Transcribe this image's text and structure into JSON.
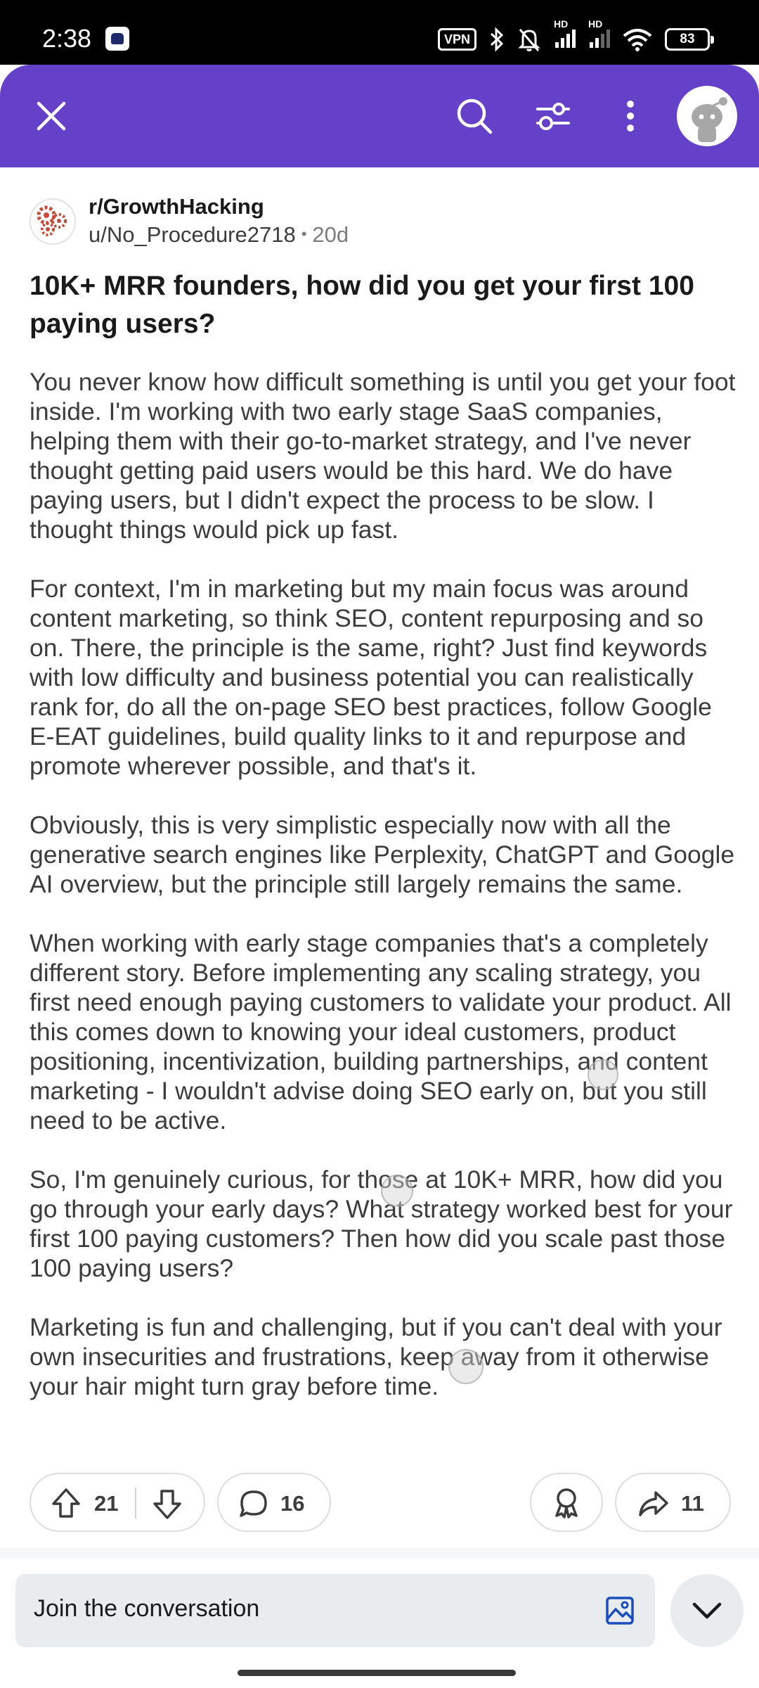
{
  "status_bar": {
    "time": "2:38",
    "vpn": "VPN",
    "sim1": "HD",
    "sim2": "HD",
    "battery": "83"
  },
  "header": {
    "icons": [
      "close-icon",
      "search-icon",
      "filter-icon",
      "more-vertical-icon",
      "avatar"
    ],
    "accent_color": "#6441c8"
  },
  "post": {
    "subreddit": "r/GrowthHacking",
    "author": "u/No_Procedure2718",
    "separator": "•",
    "age": "20d",
    "title": "10K+ MRR founders, how did you get your first 100 paying users?",
    "paragraphs": [
      "You never know how difficult something is until you get your foot inside. I'm working with two early stage SaaS companies, helping them with their go-to-market strategy, and I've never thought getting paid users would be this hard. We do have paying users, but I didn't expect the process to be slow. I thought things would pick up fast.",
      "For context, I'm in marketing but my main focus was around content marketing, so think SEO, content repurposing and so on. There, the principle is the same, right? Just find keywords with low difficulty and business potential you can realistically rank for, do all the on-page SEO best practices, follow Google E-EAT guidelines, build quality links to it and repurpose and promote wherever possible, and that's it.",
      "Obviously, this is very simplistic especially now with all the generative search engines like Perplexity, ChatGPT and Google AI overview, but the principle still largely remains the same.",
      "When working with early stage companies that's a completely different story. Before implementing any scaling strategy, you first need enough paying customers to validate your product. All this comes down to knowing your ideal customers, product positioning, incentivization, building partnerships, and content marketing - I wouldn't advise doing SEO early on, but you still need to be active.",
      "So, I'm genuinely curious, for those at 10K+ MRR, how did you go through your early days? What strategy worked best for your first 100 paying customers? Then how did you scale past those 100 paying users?",
      "Marketing is fun and challenging, but if you can't deal with your own insecurities and frustrations, keep away from it otherwise your hair might turn gray before time."
    ]
  },
  "actions": {
    "upvotes": "21",
    "comments": "16",
    "shares": "11"
  },
  "composer": {
    "placeholder": "Join the conversation"
  }
}
